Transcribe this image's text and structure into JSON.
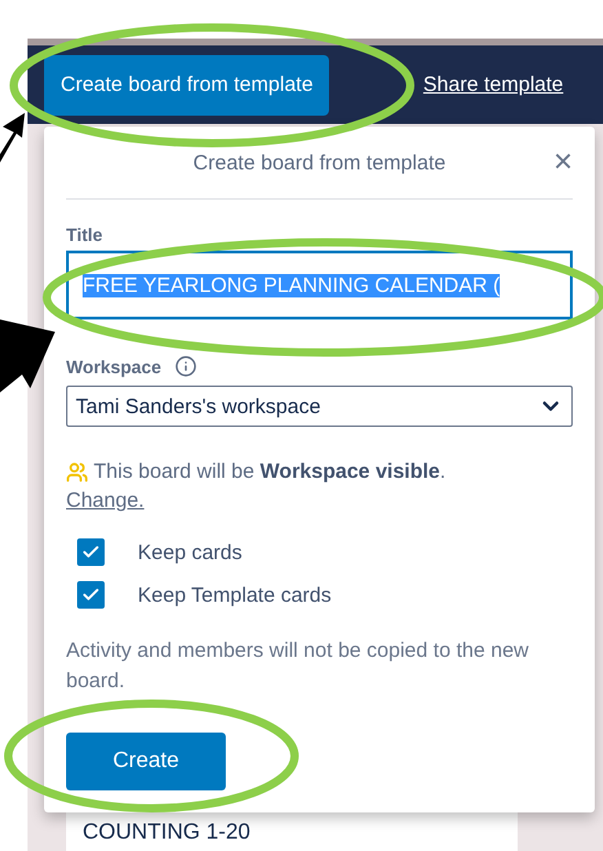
{
  "toolbar": {
    "create_button": "Create board from template",
    "share_link": "Share template"
  },
  "dialog": {
    "title": "Create board from template",
    "close": "×",
    "title_label": "Title",
    "title_value": "FREE YEARLONG PLANNING CALENDAR (",
    "title_selected": true,
    "workspace_label": "Workspace",
    "workspace_value": "Tami Sanders's workspace",
    "visibility_text": "This board will be **Workspace visible**.",
    "change_link": "Change.",
    "options": [
      {
        "label": "Keep cards",
        "checked": true
      },
      {
        "label": "Keep Template cards",
        "checked": true
      }
    ],
    "note": "Activity and members will not be copied to the new board.",
    "submit": "Create"
  },
  "background": {
    "card": "COUNTING 1-20"
  }
}
